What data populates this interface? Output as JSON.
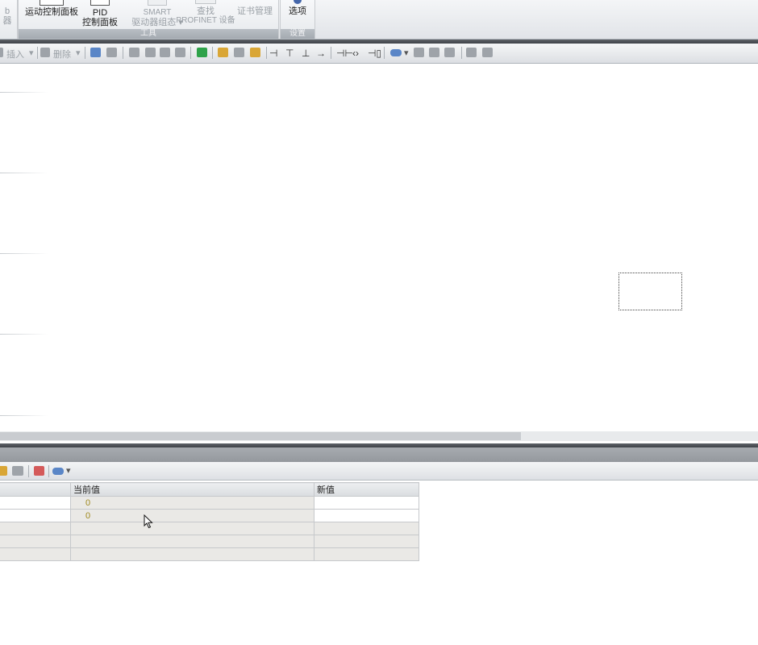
{
  "ribbon": {
    "partial_left_top": "b",
    "partial_left_bottom": "器",
    "tools_group": {
      "label": "工具",
      "buttons": {
        "motion": "运动控制面板",
        "pid_line1": "PID",
        "pid_line2": "控制面板",
        "smart_line1": "SMART",
        "smart_line2": "驱动器组态 ▾",
        "find_line1": "查找",
        "find_line2": "PROFINET 设备",
        "cert": "证书管理"
      }
    },
    "settings_group": {
      "label": "设置",
      "options": "选项"
    }
  },
  "toolbar": {
    "insert": "插入",
    "delete": "删除"
  },
  "status_table": {
    "headers": [
      "",
      "当前值",
      "新值"
    ],
    "rows": [
      {
        "name": "",
        "current": "0",
        "new": ""
      },
      {
        "name": "",
        "current": "0",
        "new": ""
      },
      {
        "name": "",
        "current": "",
        "new": ""
      },
      {
        "name": "",
        "current": "",
        "new": ""
      },
      {
        "name": "",
        "current": "",
        "new": ""
      }
    ]
  },
  "colors": {
    "value_text": "#a08a20",
    "dark_bar": "#4a4e54",
    "ribbon_group_label": "#a4aab1"
  }
}
